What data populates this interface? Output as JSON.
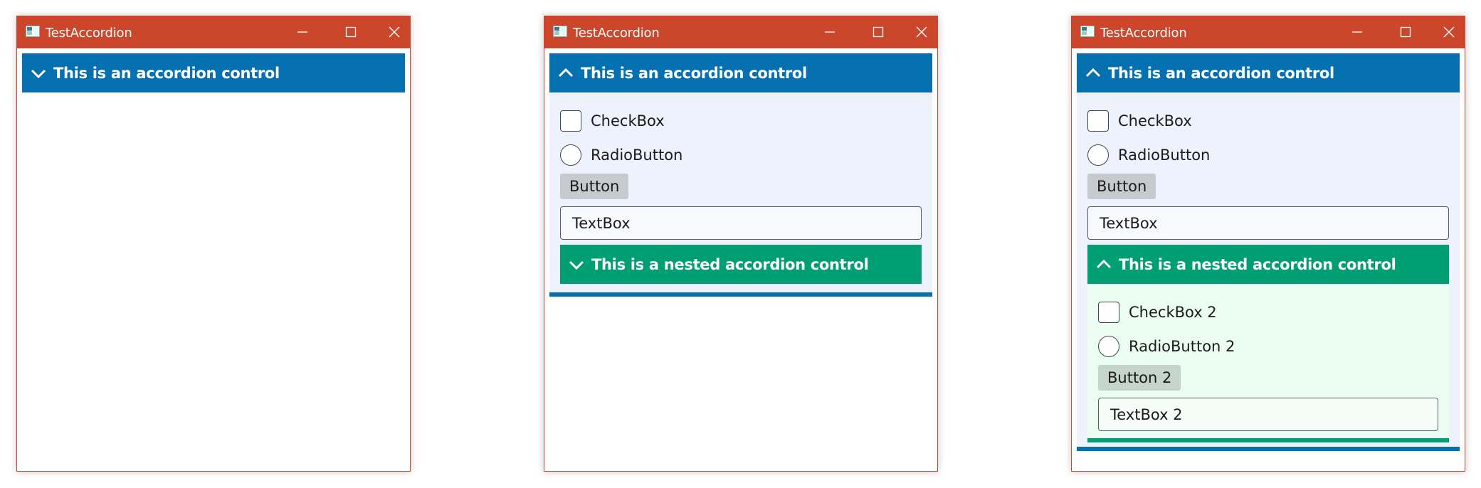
{
  "colors": {
    "titlebar": "#cc462c",
    "accordion_header": "#0470b0",
    "nested_header": "#009e73",
    "panel_bg": "#eef2fc",
    "nested_panel_bg": "#ebfcf1"
  },
  "windows": [
    {
      "title": "TestAccordion",
      "accordion": {
        "header": "This is an accordion control",
        "expanded": false,
        "chevron": "chevron-down-icon"
      }
    },
    {
      "title": "TestAccordion",
      "accordion": {
        "header": "This is an accordion control",
        "expanded": true,
        "chevron": "chevron-up-icon",
        "checkbox": "CheckBox",
        "radio": "RadioButton",
        "button": "Button",
        "textbox": "TextBox",
        "nested": {
          "header": "This is a nested accordion control",
          "expanded": false,
          "chevron": "chevron-down-icon"
        }
      }
    },
    {
      "title": "TestAccordion",
      "accordion": {
        "header": "This is an accordion control",
        "expanded": true,
        "chevron": "chevron-up-icon",
        "checkbox": "CheckBox",
        "radio": "RadioButton",
        "button": "Button",
        "textbox": "TextBox",
        "nested": {
          "header": "This is a nested accordion control",
          "expanded": true,
          "chevron": "chevron-up-icon",
          "checkbox": "CheckBox 2",
          "radio": "RadioButton 2",
          "button": "Button 2",
          "textbox": "TextBox 2"
        }
      }
    }
  ]
}
